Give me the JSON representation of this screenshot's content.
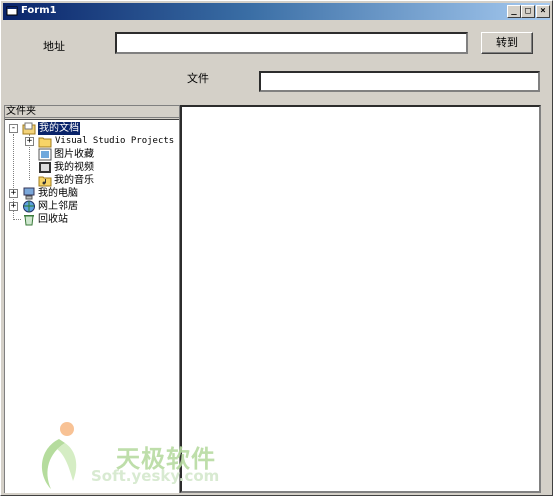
{
  "window": {
    "title": "Form1",
    "minimize_glyph": "_",
    "maximize_glyph": "□",
    "close_glyph": "×"
  },
  "address": {
    "label": "地址",
    "value": "",
    "go_button": "转到"
  },
  "file": {
    "label": "文件",
    "value": ""
  },
  "folder_panel": {
    "header": "文件夹",
    "tree": [
      {
        "label": "我的文档",
        "icon": "my-documents-icon",
        "expander": "-",
        "selected": true
      },
      {
        "label": "Visual Studio Projects",
        "icon": "folder-icon",
        "expander": "+"
      },
      {
        "label": "图片收藏",
        "icon": "pictures-folder-icon",
        "expander": ""
      },
      {
        "label": "我的视频",
        "icon": "video-folder-icon",
        "expander": ""
      },
      {
        "label": "我的音乐",
        "icon": "music-folder-icon",
        "expander": ""
      },
      {
        "label": "我的电脑",
        "icon": "my-computer-icon",
        "expander": "+"
      },
      {
        "label": "网上邻居",
        "icon": "network-icon",
        "expander": "+"
      },
      {
        "label": "回收站",
        "icon": "recycle-bin-icon",
        "expander": ""
      }
    ]
  },
  "watermark": {
    "brand": "天极软件",
    "url": "Soft.yesky.com"
  },
  "colors": {
    "titlebar_start": "#0a246a",
    "titlebar_end": "#a6caf0",
    "window_face": "#d4d0c8",
    "selection": "#0a246a"
  }
}
